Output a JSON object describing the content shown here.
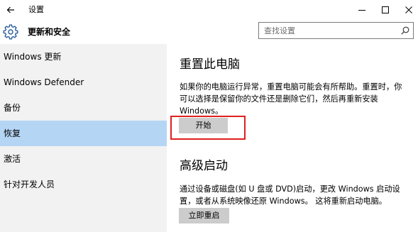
{
  "window": {
    "title": "设置"
  },
  "header": {
    "title": "更新和安全",
    "search_placeholder": "查找设置"
  },
  "sidebar": {
    "items": [
      {
        "label": "Windows 更新"
      },
      {
        "label": "Windows Defender"
      },
      {
        "label": "备份"
      },
      {
        "label": "恢复",
        "selected": true
      },
      {
        "label": "激活"
      },
      {
        "label": "针对开发人员"
      }
    ]
  },
  "reset": {
    "title": "重置此电脑",
    "desc_lines": [
      "如果你的电脑运行异常，重置电脑可能会有所帮助。重置时，你",
      "可以选择是保留你的文件还是删除它们，然后再重新安装",
      "Windows。"
    ],
    "button_label": "开始"
  },
  "advanced": {
    "title": "高级启动",
    "desc_lines": [
      "通过设备或磁盘(如 U 盘或 DVD)启动，更改 Windows 启动设",
      "置，或者从系统映像还原 Windows。 这将重新启动电脑。"
    ],
    "button_label": "立即重启"
  },
  "colors": {
    "selected_bg": "#b5d5f5",
    "sidebar_bg": "#f2f2f2",
    "button_bg": "#cccccc",
    "highlight_border": "#e02020"
  },
  "icons": [
    "back-arrow-icon",
    "minimize-icon",
    "maximize-icon",
    "close-icon",
    "gear-icon",
    "search-icon"
  ]
}
